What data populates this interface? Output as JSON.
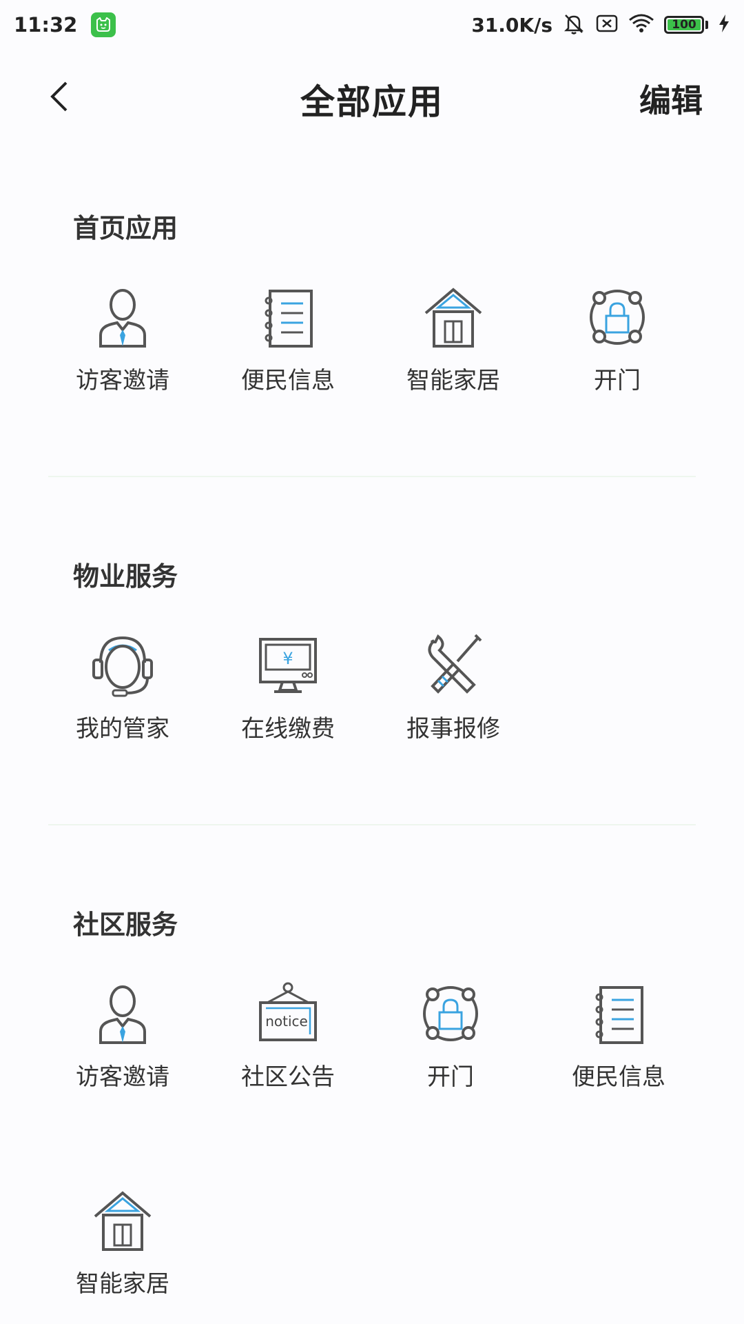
{
  "status_bar": {
    "time": "11:32",
    "net_speed": "31.0K/s",
    "battery": "100",
    "icons": [
      "app-notification-icon",
      "mute-icon",
      "sim-off-icon",
      "wifi-icon",
      "battery-icon",
      "charging-icon"
    ]
  },
  "nav": {
    "title": "全部应用",
    "edit_label": "编辑",
    "back_icon": "chevron-left-icon"
  },
  "sections": [
    {
      "title": "首页应用",
      "items": [
        {
          "label": "访客邀请",
          "icon": "visitor-icon"
        },
        {
          "label": "便民信息",
          "icon": "notebook-icon"
        },
        {
          "label": "智能家居",
          "icon": "house-icon"
        },
        {
          "label": "开门",
          "icon": "lock-icon"
        }
      ]
    },
    {
      "title": "物业服务",
      "items": [
        {
          "label": "我的管家",
          "icon": "headset-icon"
        },
        {
          "label": "在线缴费",
          "icon": "payment-monitor-icon"
        },
        {
          "label": "报事报修",
          "icon": "repair-tools-icon"
        }
      ]
    },
    {
      "title": "社区服务",
      "items": [
        {
          "label": "访客邀请",
          "icon": "visitor-icon"
        },
        {
          "label": "社区公告",
          "icon": "notice-board-icon",
          "icon_text": "notice"
        },
        {
          "label": "开门",
          "icon": "lock-icon"
        },
        {
          "label": "便民信息",
          "icon": "notebook-icon"
        },
        {
          "label": "智能家居",
          "icon": "house-icon"
        }
      ]
    }
  ],
  "colors": {
    "accent_blue": "#3aa3e0",
    "icon_gray": "#555555",
    "badge_green": "#3cc04a"
  }
}
